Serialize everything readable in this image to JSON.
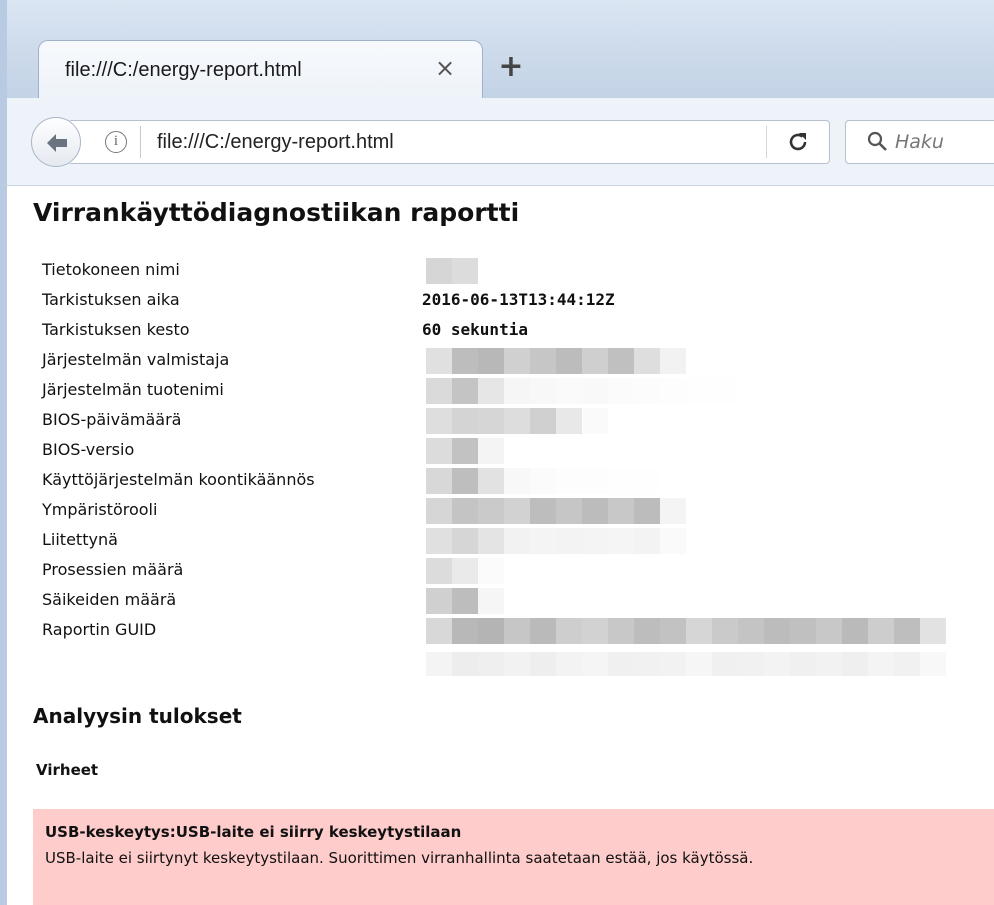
{
  "browser": {
    "tab_title": "file:///C:/energy-report.html",
    "tab_close": "×",
    "new_tab": "+",
    "url": "file:///C:/energy-report.html",
    "search_placeholder": "Haku"
  },
  "report": {
    "title": "Virrankäyttödiagnostiikan raportti",
    "rows": [
      {
        "label": "Tietokoneen nimi",
        "value": ""
      },
      {
        "label": "Tarkistuksen aika",
        "value": "2016-06-13T13:44:12Z"
      },
      {
        "label": "Tarkistuksen kesto",
        "value": "60 sekuntia"
      },
      {
        "label": "Järjestelmän valmistaja",
        "value": ""
      },
      {
        "label": "Järjestelmän tuotenimi",
        "value": ""
      },
      {
        "label": "BIOS-päivämäärä",
        "value": ""
      },
      {
        "label": "BIOS-versio",
        "value": ""
      },
      {
        "label": "Käyttöjärjestelmän koontikäännös",
        "value": ""
      },
      {
        "label": "Ympäristörooli",
        "value": ""
      },
      {
        "label": "Liitettynä",
        "value": ""
      },
      {
        "label": "Prosessien määrä",
        "value": ""
      },
      {
        "label": "Säikeiden määrä",
        "value": ""
      },
      {
        "label": "Raportin GUID",
        "value": ""
      }
    ],
    "analysis_title": "Analyysin tulokset",
    "errors_title": "Virheet",
    "error": {
      "title": "USB-keskeytys:USB-laite ei siirry keskeytystilaan",
      "text": "USB-laite ei siirtynyt keskeytystilaan. Suorittimen virranhallinta saatetaan estää, jos käytössä."
    }
  },
  "colors": {
    "error_background": "#ffcccc",
    "chrome_background": "#eef3f9"
  }
}
